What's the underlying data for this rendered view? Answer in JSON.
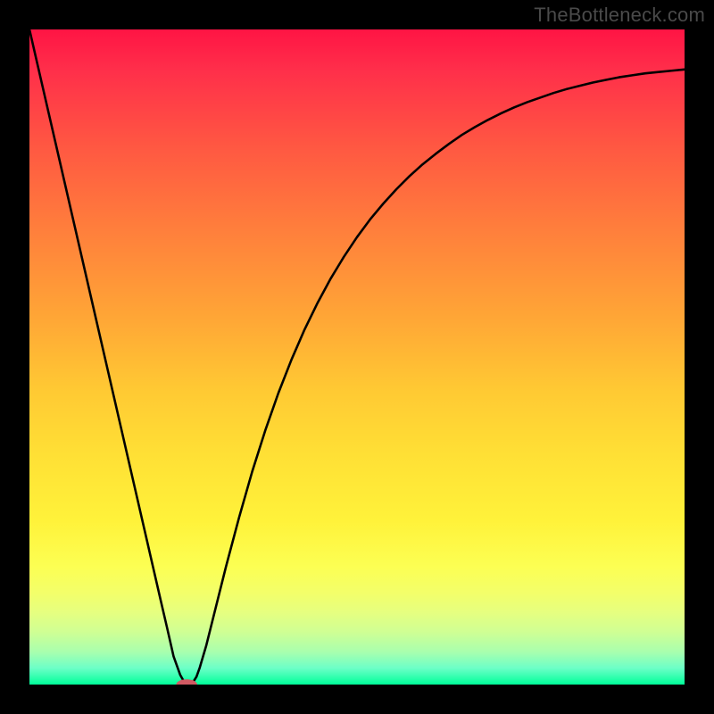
{
  "watermark": "TheBottleneck.com",
  "chart_data": {
    "type": "line",
    "title": "",
    "xlabel": "",
    "ylabel": "",
    "xlim": [
      0,
      100
    ],
    "ylim": [
      0,
      100
    ],
    "grid": false,
    "legend": false,
    "series": [
      {
        "name": "bottleneck-curve",
        "x": [
          0.0,
          2.0,
          4.0,
          6.0,
          8.0,
          10.0,
          12.0,
          14.0,
          16.0,
          18.0,
          20.0,
          21.0,
          22.0,
          23.0,
          23.5,
          24.0,
          24.5,
          25.0,
          25.5,
          26.0,
          27.0,
          28.0,
          30.0,
          32.0,
          34.0,
          36.0,
          38.0,
          40.0,
          42.0,
          44.0,
          46.0,
          48.0,
          50.0,
          52.0,
          54.0,
          56.0,
          58.0,
          60.0,
          62.0,
          64.0,
          66.0,
          68.0,
          70.0,
          72.0,
          74.0,
          76.0,
          78.0,
          80.0,
          82.0,
          84.0,
          86.0,
          88.0,
          90.0,
          92.0,
          94.0,
          96.0,
          98.0,
          100.0
        ],
        "values": [
          100.0,
          91.3,
          82.6,
          73.9,
          65.2,
          56.5,
          47.8,
          39.1,
          30.4,
          21.7,
          13.0,
          8.7,
          4.3,
          1.5,
          0.6,
          0.0,
          0.0,
          0.4,
          1.2,
          2.6,
          6.0,
          10.0,
          18.0,
          25.5,
          32.5,
          38.8,
          44.5,
          49.6,
          54.2,
          58.3,
          62.0,
          65.3,
          68.3,
          71.0,
          73.4,
          75.6,
          77.6,
          79.4,
          81.0,
          82.5,
          83.9,
          85.1,
          86.2,
          87.2,
          88.1,
          88.9,
          89.6,
          90.3,
          90.9,
          91.4,
          91.9,
          92.3,
          92.7,
          93.0,
          93.3,
          93.5,
          93.7,
          93.9
        ]
      }
    ],
    "marker": {
      "name": "optimal-point",
      "x": 24.0,
      "y": 0.0,
      "color": "#d15a63",
      "rx": 1.6,
      "ry": 0.8
    },
    "background_gradient": {
      "orientation": "vertical",
      "stops": [
        {
          "pos": 0.0,
          "color": "#ff1444"
        },
        {
          "pos": 0.3,
          "color": "#ff7d3c"
        },
        {
          "pos": 0.6,
          "color": "#ffe035"
        },
        {
          "pos": 0.85,
          "color": "#f3ff6a"
        },
        {
          "pos": 1.0,
          "color": "#00ff99"
        }
      ]
    }
  }
}
